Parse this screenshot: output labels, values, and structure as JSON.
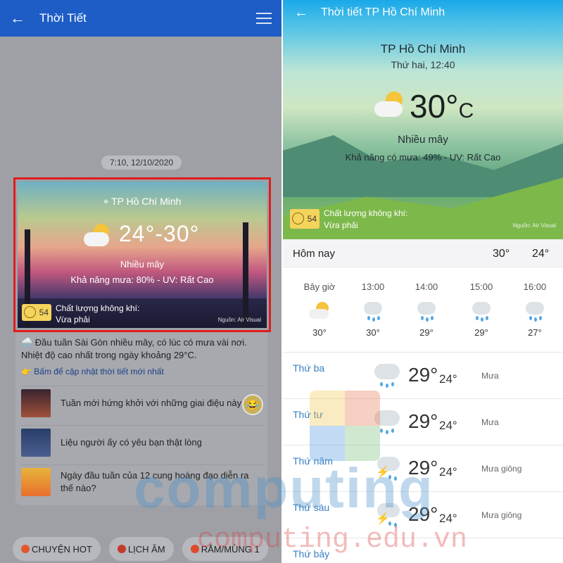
{
  "left": {
    "appbar": {
      "title": "Thời Tiết",
      "back_icon": "back-arrow-icon",
      "menu_icon": "list-menu-icon"
    },
    "timestamp": "7:10, 12/10/2020",
    "card": {
      "location": "TP Hồ Chí Minh",
      "temp_range": "24°-30°",
      "condition": "Nhiều mây",
      "rain_uv": "Khả năng mưa: 80% - UV: Rất Cao",
      "aq_value": "54",
      "aq_label": "Chất lượng không khí:",
      "aq_status": "Vừa phải",
      "source": "Nguồn: Air Visual"
    },
    "summary": "🌧️ Đầu tuần Sài Gòn nhiều mây, có lúc có mưa vài nơi. Nhiệt độ cao nhất trong ngày khoảng 29°C.",
    "update_link": "👉 Bấm để cập nhật thời tiết mới nhất",
    "news": [
      {
        "title": "Tuần mới hứng khởi với những giai điệu này"
      },
      {
        "title": "Liệu người ấy có yêu bạn thật lòng"
      },
      {
        "title": "Ngày đầu tuần của 12 cung hoàng đạo diễn ra thế nào?"
      }
    ],
    "chips": [
      {
        "label": "CHUYỆN HOT"
      },
      {
        "label": "LỊCH ÂM"
      },
      {
        "label": "RẰM/MÙNG 1"
      }
    ]
  },
  "right": {
    "appbar": {
      "title": "Thời tiết TP Hồ Chí Minh"
    },
    "city": "TP Hồ Chí Minh",
    "day_time": "Thứ hai, 12:40",
    "temp": "30°",
    "temp_unit": "C",
    "condition": "Nhiều mây",
    "rain_uv": "Khả năng có mưa: 49% - UV: Rất Cao",
    "aq_value": "54",
    "aq_label": "Chất lượng không khí:",
    "aq_status": "Vừa phải",
    "source": "Nguồn: Air Visual",
    "today": {
      "label": "Hôm nay",
      "high": "30°",
      "low": "24°"
    },
    "hourly": [
      {
        "time": "Bây giờ",
        "icon": "partly-cloudy-icon",
        "temp": "30°"
      },
      {
        "time": "13:00",
        "icon": "rain-cloud-icon",
        "temp": "30°"
      },
      {
        "time": "14:00",
        "icon": "rain-cloud-icon",
        "temp": "29°"
      },
      {
        "time": "15:00",
        "icon": "rain-cloud-icon",
        "temp": "29°"
      },
      {
        "time": "16:00",
        "icon": "rain-cloud-icon",
        "temp": "27°"
      }
    ],
    "daily": [
      {
        "day": "Thứ ba",
        "high": "29°",
        "low": "24°",
        "desc": "Mưa",
        "icon": "rain-cloud-icon"
      },
      {
        "day": "Thứ tư",
        "high": "29°",
        "low": "24°",
        "desc": "Mưa",
        "icon": "rain-cloud-icon"
      },
      {
        "day": "Thứ năm",
        "high": "29°",
        "low": "24°",
        "desc": "Mưa giông",
        "icon": "thunderstorm-icon"
      },
      {
        "day": "Thứ sáu",
        "high": "29°",
        "low": "24°",
        "desc": "Mưa giông",
        "icon": "thunderstorm-icon"
      },
      {
        "day": "Thứ bảy",
        "high": "",
        "low": "",
        "desc": "",
        "icon": ""
      }
    ]
  },
  "watermark": {
    "brand": "computing",
    "url": "computing.edu.vn"
  },
  "colors": {
    "appbar_blue": "#1d5dc5",
    "highlight_red": "#e01d1d",
    "day_blue": "#3a7fc2",
    "aq_yellow": "#f5d45c"
  }
}
